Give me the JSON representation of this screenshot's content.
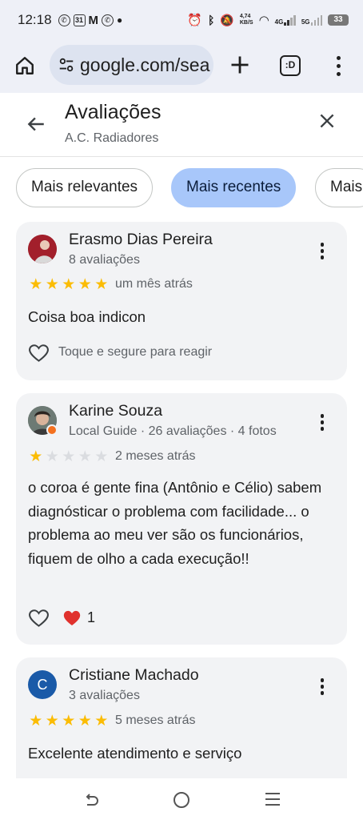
{
  "status_bar": {
    "time": "12:18",
    "notification_icons": [
      "whatsapp-icon",
      "calendar-icon",
      "gmail-icon",
      "whatsapp-icon",
      "dot-icon"
    ],
    "calendar_day": "31",
    "net_speed": "4,74\nKB/S",
    "network_4g": "4G",
    "network_5g": "5G",
    "battery": "33"
  },
  "browser": {
    "url": "google.com/sea",
    "tabs_label": ":D"
  },
  "panel": {
    "title": "Avaliações",
    "subtitle": "A.C. Radiadores"
  },
  "chips": [
    {
      "label": "Mais relevantes",
      "active": false
    },
    {
      "label": "Mais recentes",
      "active": true
    },
    {
      "label": "Mais",
      "active": false
    }
  ],
  "reviews": [
    {
      "name": "Erasmo Dias Pereira",
      "meta": "8 avaliações",
      "rating": 5,
      "when": "um mês atrás",
      "text": "Coisa boa indicon",
      "reaction_hint": "Toque e segure para reagir"
    },
    {
      "name": "Karine Souza",
      "meta": "Local Guide · 26 avaliações · 4 fotos",
      "rating": 1,
      "when": "2 meses atrás",
      "text": "o coroa é gente fina (Antônio e Célio) sabem diagnósticar o problema com facilidade... o problema ao meu ver são os funcionários, fiquem de olho a cada execução!!",
      "reaction_count": "1"
    },
    {
      "name": "Cristiane Machado",
      "meta": "3 avaliações",
      "avatar_letter": "C",
      "rating": 5,
      "when": "5 meses atrás",
      "text": "Excelente atendimento e serviço"
    }
  ],
  "colors": {
    "star": "#fbbc04",
    "active_chip": "#a8c7fa",
    "card_bg": "#f2f3f5",
    "avatar_c": "#1a5aa8"
  }
}
